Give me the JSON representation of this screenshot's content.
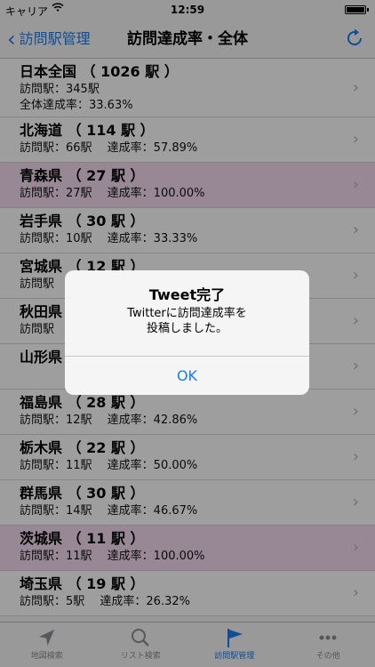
{
  "status": {
    "carrier": "キャリア",
    "time": "12:59"
  },
  "nav": {
    "back": "訪問駅管理",
    "title": "訪問達成率・全体"
  },
  "rows": [
    {
      "title": "日本全国 （ 1026 駅 ）",
      "line1": "訪問駅：345駅",
      "line2": "全体達成率：33.63%"
    },
    {
      "title": "北海道 （ 114 駅 ）",
      "line1": "訪問駅：66駅　 達成率：57.89%"
    },
    {
      "title": "青森県 （ 27 駅 ）",
      "line1": "訪問駅：27駅　 達成率：100.00%"
    },
    {
      "title": "岩手県 （ 30 駅 ）",
      "line1": "訪問駅：10駅　 達成率：33.33%"
    },
    {
      "title": "宮城県 （ 12 駅 ）",
      "line1": "訪問駅"
    },
    {
      "title": "秋田県",
      "line1": "訪問駅"
    },
    {
      "title": "山形県",
      "line1": ""
    },
    {
      "title": "福島県 （ 28 駅 ）",
      "line1": "訪問駅：12駅　 達成率：42.86%"
    },
    {
      "title": "栃木県 （ 22 駅 ）",
      "line1": "訪問駅：11駅　 達成率：50.00%"
    },
    {
      "title": "群馬県 （ 30 駅 ）",
      "line1": "訪問駅：14駅　 達成率：46.67%"
    },
    {
      "title": "茨城県 （ 11 駅 ）",
      "line1": "訪問駅：11駅　 達成率：100.00%"
    },
    {
      "title": "埼玉県 （ 19 駅 ）",
      "line1": "訪問駅：5駅　 達成率：26.32%"
    }
  ],
  "alert": {
    "title": "Tweet完了",
    "message": "Twitterに訪問達成率を\n投稿しました。",
    "ok": "OK"
  },
  "tabs": [
    "地図検索",
    "リスト検索",
    "訪問駅管理",
    "その他"
  ],
  "colors": {
    "accent": "#1a7cf5",
    "highlight_row": "#f6dcf3"
  }
}
